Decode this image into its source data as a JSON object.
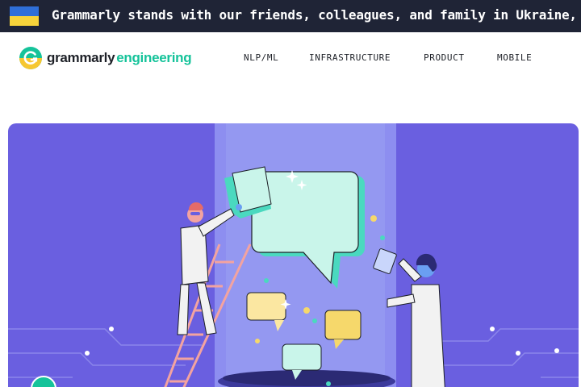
{
  "banner": {
    "text": "Grammarly stands with our friends, colleagues, and family in Ukraine, and"
  },
  "logo": {
    "wordmark": "grammarly",
    "suffix": "engineering"
  },
  "nav": {
    "items": [
      "NLP/ML",
      "INFRASTRUCTURE",
      "PRODUCT",
      "MOBILE"
    ]
  },
  "colors": {
    "banner_bg": "#1f2436",
    "brand_green": "#15c39a",
    "hero_bg": "#6a5fe0"
  }
}
